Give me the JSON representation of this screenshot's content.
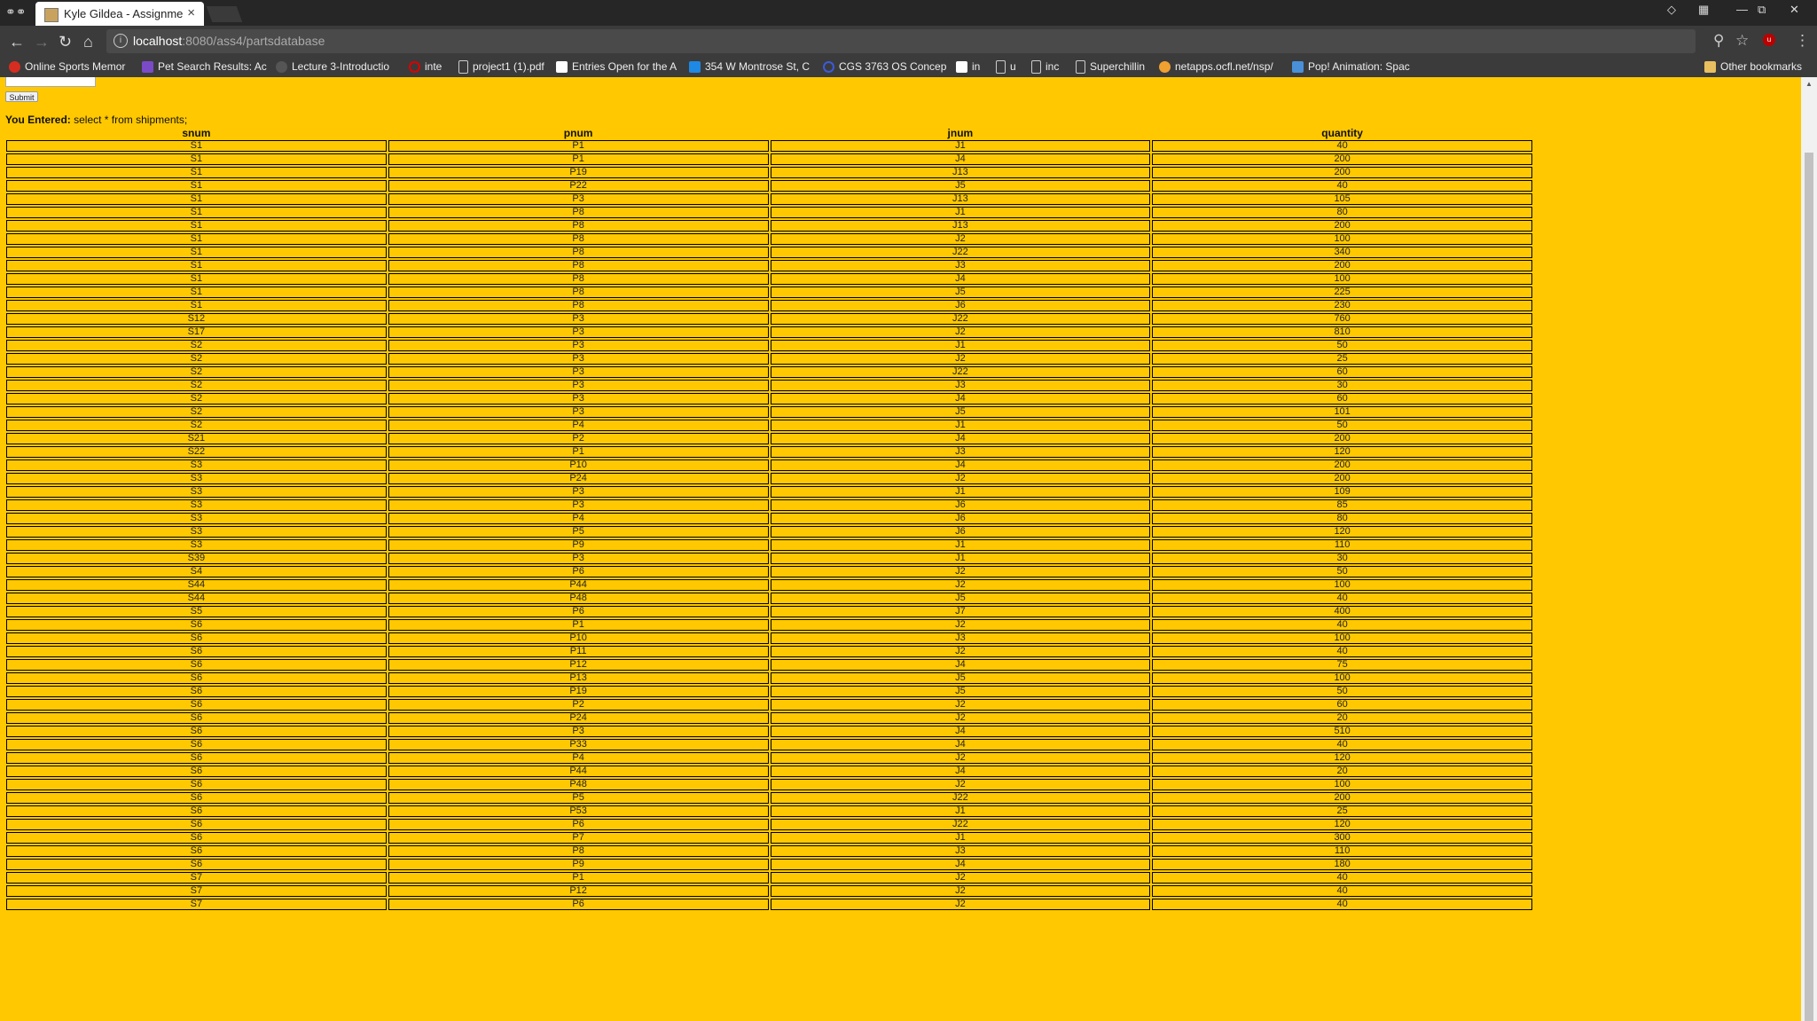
{
  "browser": {
    "tab_title": "Kyle Gildea - Assignmen",
    "url_host": "localhost",
    "url_path": ":8080/ass4/partsdatabase",
    "bookmarks": [
      "Online Sports Memor",
      "Pet Search Results: Ac",
      "Lecture 3-Introductio",
      "inte",
      "project1 (1).pdf",
      "Entries Open for the A",
      "354 W Montrose St, C",
      "CGS 3763 OS Concep",
      "in",
      "u",
      "inc",
      "Superchillin",
      "netapps.ocfl.net/nsp/",
      "Pop! Animation: Spac"
    ],
    "other_bookmarks": "Other bookmarks"
  },
  "form": {
    "submit_label": "Submit",
    "entered_label": "You Entered:",
    "entered_query": " select * from shipments;"
  },
  "table": {
    "headers": [
      "snum",
      "pnum",
      "jnum",
      "quantity"
    ],
    "rows": [
      [
        "S1",
        "P1",
        "J1",
        "40"
      ],
      [
        "S1",
        "P1",
        "J4",
        "200"
      ],
      [
        "S1",
        "P19",
        "J13",
        "200"
      ],
      [
        "S1",
        "P22",
        "J5",
        "40"
      ],
      [
        "S1",
        "P3",
        "J13",
        "105"
      ],
      [
        "S1",
        "P8",
        "J1",
        "80"
      ],
      [
        "S1",
        "P8",
        "J13",
        "200"
      ],
      [
        "S1",
        "P8",
        "J2",
        "100"
      ],
      [
        "S1",
        "P8",
        "J22",
        "340"
      ],
      [
        "S1",
        "P8",
        "J3",
        "200"
      ],
      [
        "S1",
        "P8",
        "J4",
        "100"
      ],
      [
        "S1",
        "P8",
        "J5",
        "225"
      ],
      [
        "S1",
        "P8",
        "J6",
        "230"
      ],
      [
        "S12",
        "P3",
        "J22",
        "760"
      ],
      [
        "S17",
        "P3",
        "J2",
        "810"
      ],
      [
        "S2",
        "P3",
        "J1",
        "50"
      ],
      [
        "S2",
        "P3",
        "J2",
        "25"
      ],
      [
        "S2",
        "P3",
        "J22",
        "60"
      ],
      [
        "S2",
        "P3",
        "J3",
        "30"
      ],
      [
        "S2",
        "P3",
        "J4",
        "60"
      ],
      [
        "S2",
        "P3",
        "J5",
        "101"
      ],
      [
        "S2",
        "P4",
        "J1",
        "50"
      ],
      [
        "S21",
        "P2",
        "J4",
        "200"
      ],
      [
        "S22",
        "P1",
        "J3",
        "120"
      ],
      [
        "S3",
        "P10",
        "J4",
        "200"
      ],
      [
        "S3",
        "P24",
        "J2",
        "200"
      ],
      [
        "S3",
        "P3",
        "J1",
        "109"
      ],
      [
        "S3",
        "P3",
        "J6",
        "85"
      ],
      [
        "S3",
        "P4",
        "J6",
        "80"
      ],
      [
        "S3",
        "P5",
        "J6",
        "120"
      ],
      [
        "S3",
        "P9",
        "J1",
        "110"
      ],
      [
        "S39",
        "P3",
        "J1",
        "30"
      ],
      [
        "S4",
        "P6",
        "J2",
        "50"
      ],
      [
        "S44",
        "P44",
        "J2",
        "100"
      ],
      [
        "S44",
        "P48",
        "J5",
        "40"
      ],
      [
        "S5",
        "P6",
        "J7",
        "400"
      ],
      [
        "S6",
        "P1",
        "J2",
        "40"
      ],
      [
        "S6",
        "P10",
        "J3",
        "100"
      ],
      [
        "S6",
        "P11",
        "J2",
        "40"
      ],
      [
        "S6",
        "P12",
        "J4",
        "75"
      ],
      [
        "S6",
        "P13",
        "J5",
        "100"
      ],
      [
        "S6",
        "P19",
        "J5",
        "50"
      ],
      [
        "S6",
        "P2",
        "J2",
        "60"
      ],
      [
        "S6",
        "P24",
        "J2",
        "20"
      ],
      [
        "S6",
        "P3",
        "J4",
        "510"
      ],
      [
        "S6",
        "P33",
        "J4",
        "40"
      ],
      [
        "S6",
        "P4",
        "J2",
        "120"
      ],
      [
        "S6",
        "P44",
        "J4",
        "20"
      ],
      [
        "S6",
        "P48",
        "J2",
        "100"
      ],
      [
        "S6",
        "P5",
        "J22",
        "200"
      ],
      [
        "S6",
        "P53",
        "J1",
        "25"
      ],
      [
        "S6",
        "P6",
        "J22",
        "120"
      ],
      [
        "S6",
        "P7",
        "J1",
        "300"
      ],
      [
        "S6",
        "P8",
        "J3",
        "110"
      ],
      [
        "S6",
        "P9",
        "J4",
        "180"
      ],
      [
        "S7",
        "P1",
        "J2",
        "40"
      ],
      [
        "S7",
        "P12",
        "J2",
        "40"
      ],
      [
        "S7",
        "P6",
        "J2",
        "40"
      ]
    ]
  }
}
